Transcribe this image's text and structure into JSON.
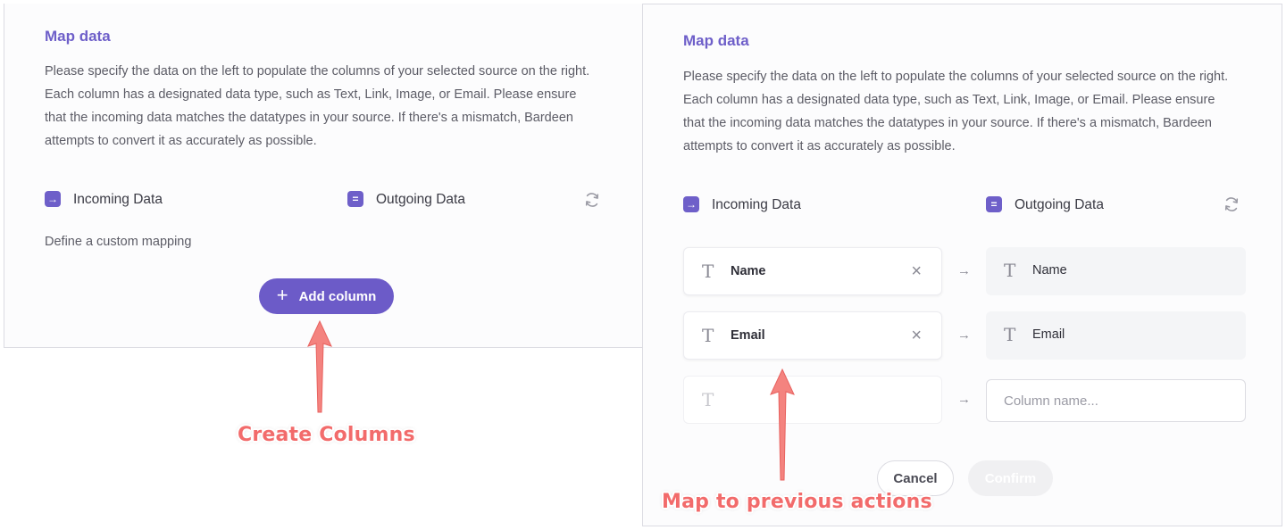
{
  "left_panel": {
    "title": "Map data",
    "description": "Please specify the data on the left to populate the columns of your selected source on the right. Each column has a designated data type, such as Text, Link, Image, or Email. Please ensure that the incoming data matches the datatypes in your source. If there's a mismatch, Bardeen attempts to convert it as accurately as possible.",
    "incoming_label": "Incoming Data",
    "outgoing_label": "Outgoing Data",
    "hint": "Define a custom mapping",
    "add_button_label": "Add column"
  },
  "right_panel": {
    "title": "Map data",
    "description": "Please specify the data on the left to populate the columns of your selected source on the right. Each column has a designated data type, such as Text, Link, Image, or Email. Please ensure that the incoming data matches the datatypes in your source. If there's a mismatch, Bardeen attempts to convert it as accurately as possible.",
    "incoming_label": "Incoming Data",
    "outgoing_label": "Outgoing Data",
    "rows": [
      {
        "incoming": "Name",
        "outgoing": "Name"
      },
      {
        "incoming": "Email",
        "outgoing": "Email"
      }
    ],
    "new_column_placeholder": "Column name...",
    "cancel_label": "Cancel",
    "confirm_label": "Confirm"
  },
  "annotations": {
    "create_columns": "Create Columns",
    "map_previous": "Map to previous actions"
  },
  "icons": {
    "text_type": "T",
    "remove": "×",
    "map_arrow": "→",
    "incoming": "→",
    "outgoing": "="
  },
  "colors": {
    "accent": "#6c5bc8",
    "annotation": "#f26b6b"
  }
}
